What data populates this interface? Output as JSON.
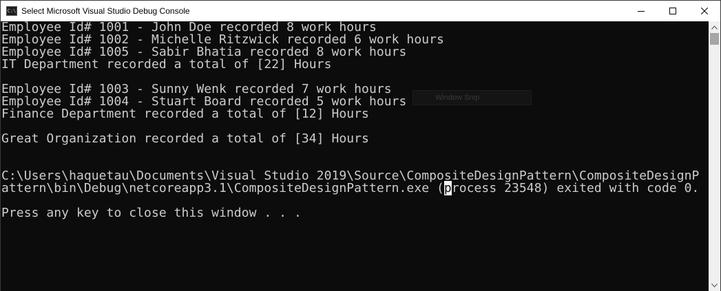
{
  "window": {
    "title": "Select Microsoft Visual Studio Debug Console",
    "icon_label": "C:\\",
    "controls": [
      "minimize-icon",
      "maximize-icon",
      "close-icon"
    ]
  },
  "console": {
    "lines": [
      "Employee Id# 1001 - John Doe recorded 8 work hours",
      "Employee Id# 1002 - Michelle Ritzwick recorded 6 work hours",
      "Employee Id# 1005 - Sabir Bhatia recorded 8 work hours",
      "IT Department recorded a total of [22] Hours",
      "",
      "Employee Id# 1003 - Sunny Wenk recorded 7 work hours",
      "Employee Id# 1004 - Stuart Board recorded 5 work hours",
      "Finance Department recorded a total of [12] Hours",
      "",
      "Great Organization recorded a total of [34] Hours",
      "",
      "",
      "C:\\Users\\haquetau\\Documents\\Visual Studio 2019\\Source\\CompositeDesignPattern\\CompositeDesignP",
      "attern\\bin\\Debug\\netcoreapp3.1\\CompositeDesignPattern.exe (",
      "",
      "Press any key to close this window . . ."
    ],
    "cursor_char": "p",
    "line14_suffix": "rocess 23548) exited with code 0.",
    "overlay_text": "Window Snip"
  },
  "colors": {
    "console_bg": "#0c0c0c",
    "console_text": "#cccccc",
    "titlebar_bg": "#ffffff"
  }
}
